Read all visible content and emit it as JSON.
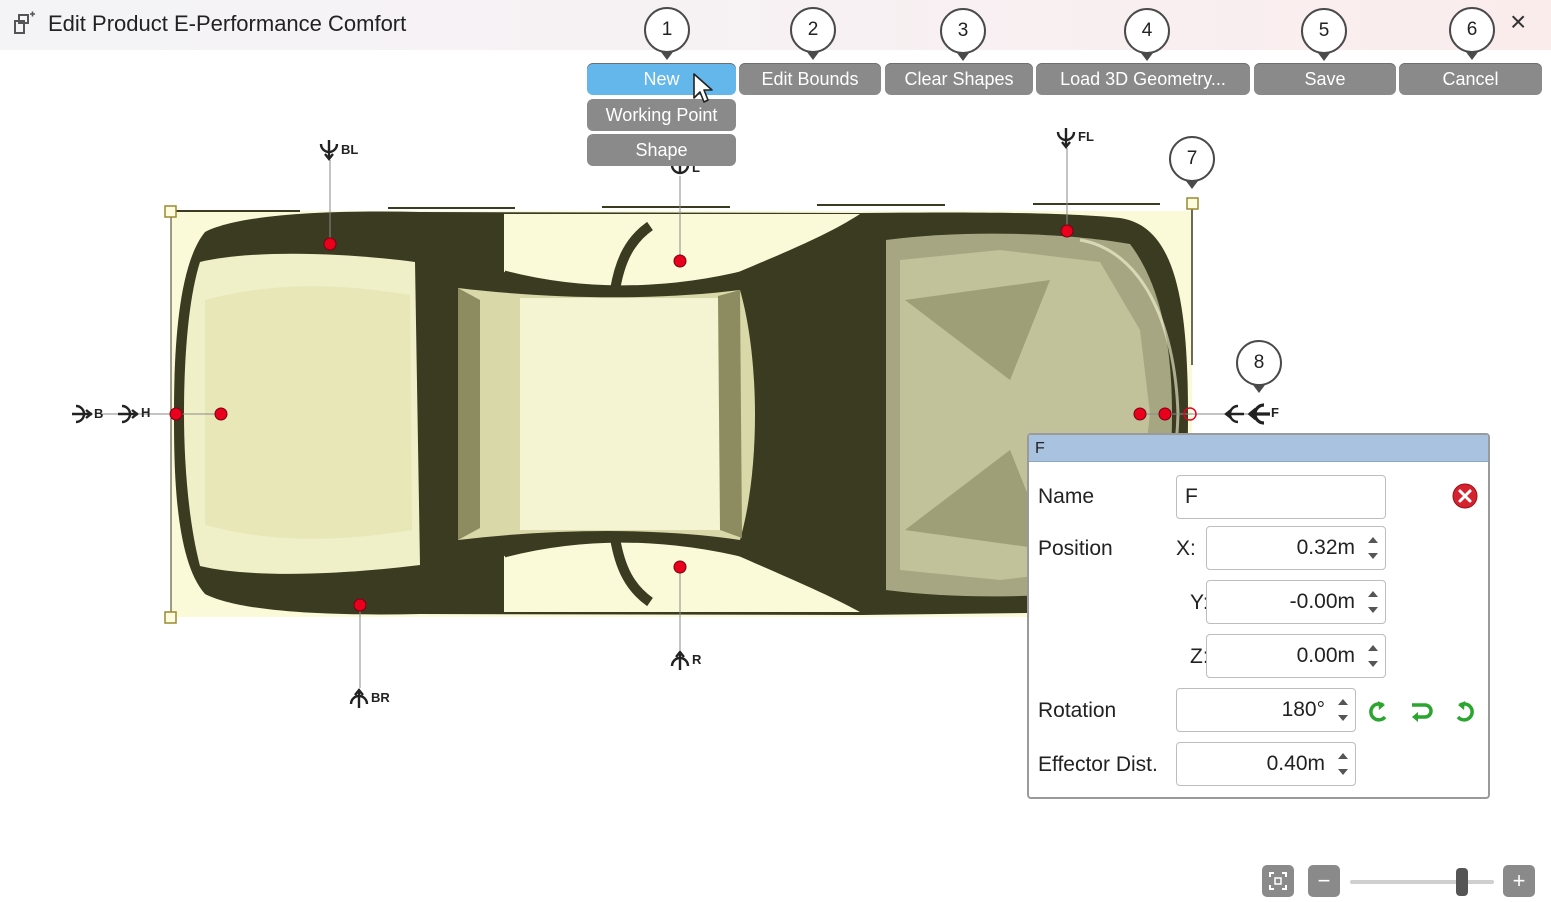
{
  "window": {
    "title": "Edit Product E-Performance Comfort",
    "close_glyph": "×",
    "app_icon": "product-edit-icon"
  },
  "toolbar": {
    "new_label": "New",
    "edit_bounds_label": "Edit Bounds",
    "clear_shapes_label": "Clear Shapes",
    "load_geometry_label": "Load 3D Geometry...",
    "save_label": "Save",
    "cancel_label": "Cancel"
  },
  "new_menu": {
    "items": [
      "Working Point",
      "Shape"
    ]
  },
  "callouts": [
    "1",
    "2",
    "3",
    "4",
    "5",
    "6",
    "7",
    "8"
  ],
  "working_points": {
    "labels": [
      "BL",
      "FL",
      "L",
      "B",
      "H",
      "R",
      "BR",
      "F"
    ]
  },
  "properties_panel": {
    "header": "F",
    "name_label": "Name",
    "name_value": "F",
    "position_label": "Position",
    "x_label": "X:",
    "x_value": "0.32m",
    "y_label": "Y:",
    "y_value": "-0.00m",
    "z_label": "Z:",
    "z_value": "0.00m",
    "rotation_label": "Rotation",
    "rotation_value": "180°",
    "effector_label": "Effector Dist.",
    "effector_value": "0.40m"
  },
  "zoom": {
    "level_fraction": 0.78,
    "minus_glyph": "−",
    "plus_glyph": "+"
  },
  "colors": {
    "accent": "#63b7ea",
    "button_gray": "#8a8a8a",
    "car_body": "#3b3b22",
    "canvas_fill": "#fbfad8",
    "point_red": "#e8001c",
    "panel_header": "#a9c2df",
    "action_green": "#2aa52e"
  }
}
